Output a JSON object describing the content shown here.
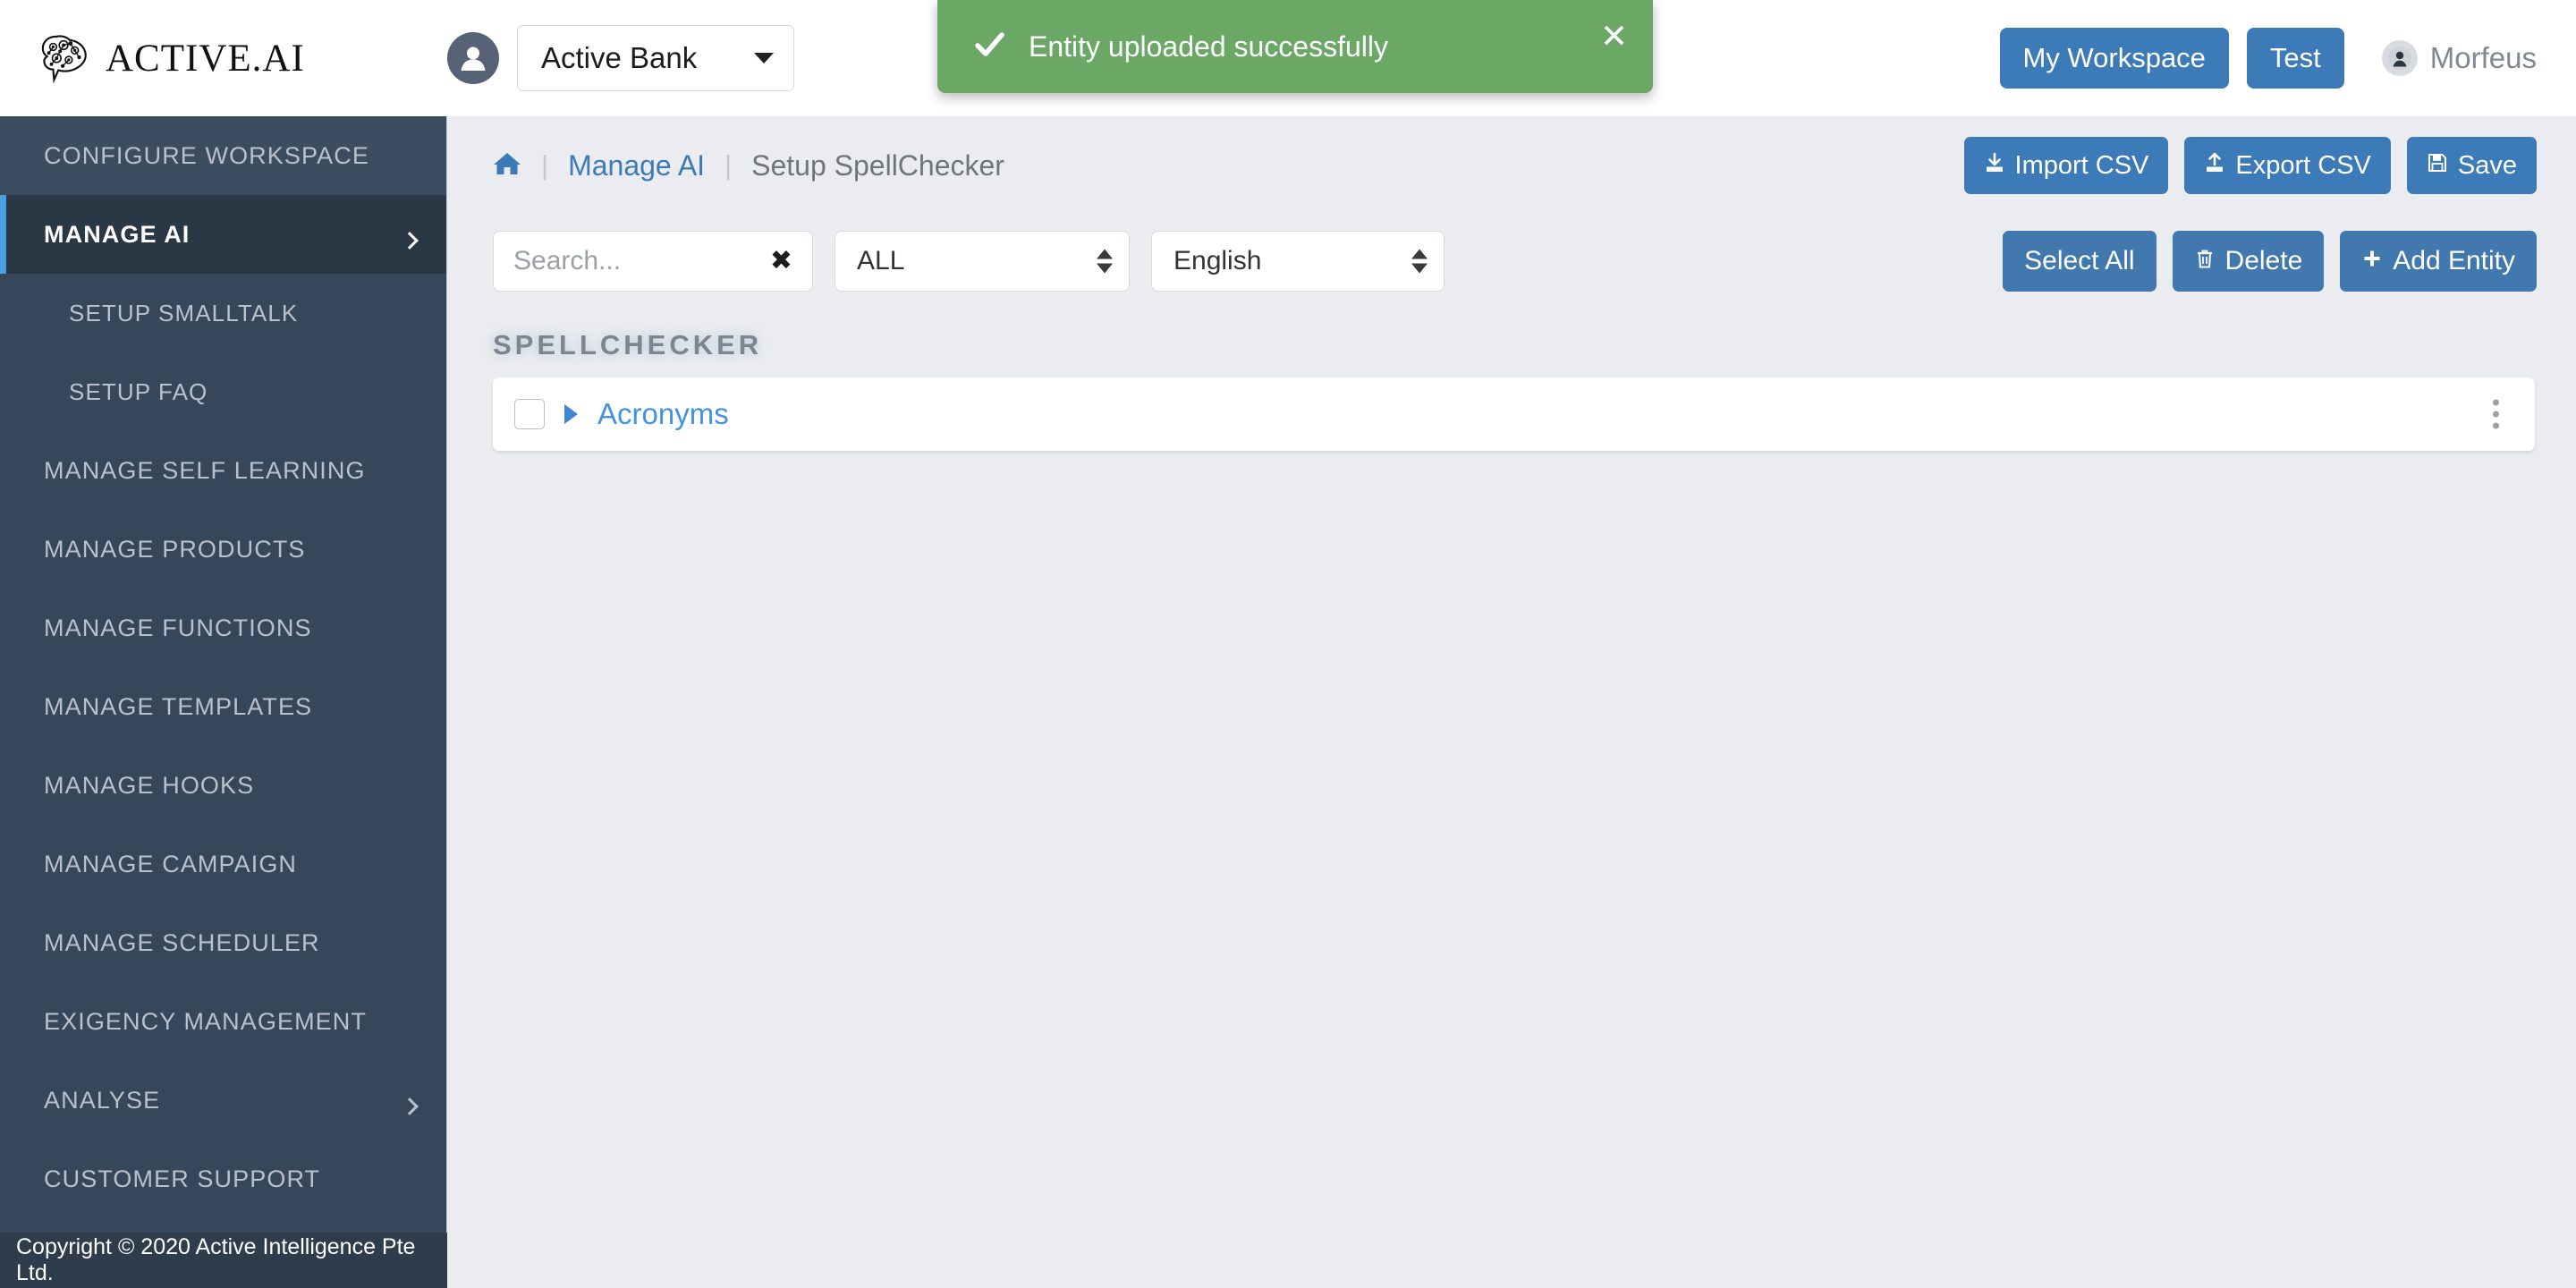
{
  "brand": {
    "name": "ACTIVE.AI",
    "logo_icon": "brain-icon"
  },
  "header": {
    "org_avatar_icon": "user-avatar-icon",
    "org_name": "Active Bank",
    "org_caret_icon": "caret-down-icon",
    "workspace_button": "My Workspace",
    "test_button": "Test",
    "user_name": "Morfeus",
    "user_avatar_icon": "user-circle-icon",
    "accent_blue": "#3d7ab8"
  },
  "toast": {
    "message": "Entity uploaded successfully",
    "check_icon": "check-icon",
    "close_icon": "close-icon",
    "close_label": "✕",
    "background": "#6ba866"
  },
  "sidebar": {
    "items": [
      {
        "label": "CONFIGURE WORKSPACE",
        "style": "head",
        "chevron": false
      },
      {
        "label": "MANAGE AI",
        "style": "active",
        "chevron": true
      },
      {
        "label": "SETUP SMALLTALK",
        "style": "sub",
        "chevron": false
      },
      {
        "label": "SETUP FAQ",
        "style": "sub",
        "chevron": false
      },
      {
        "label": "MANAGE SELF LEARNING",
        "style": "",
        "chevron": false
      },
      {
        "label": "MANAGE PRODUCTS",
        "style": "",
        "chevron": false
      },
      {
        "label": "MANAGE FUNCTIONS",
        "style": "",
        "chevron": false
      },
      {
        "label": "MANAGE TEMPLATES",
        "style": "",
        "chevron": false
      },
      {
        "label": "MANAGE HOOKS",
        "style": "",
        "chevron": false
      },
      {
        "label": "MANAGE CAMPAIGN",
        "style": "",
        "chevron": false
      },
      {
        "label": "MANAGE SCHEDULER",
        "style": "",
        "chevron": false
      },
      {
        "label": "EXIGENCY MANAGEMENT",
        "style": "",
        "chevron": false
      },
      {
        "label": "ANALYSE",
        "style": "",
        "chevron": true
      },
      {
        "label": "CUSTOMER SUPPORT",
        "style": "",
        "chevron": false
      }
    ],
    "footer": "Copyright © 2020 Active Intelligence Pte Ltd.",
    "active_accent": "#4a9fe0",
    "background": "#37475a"
  },
  "breadcrumb": {
    "home_icon": "home-icon",
    "separator": "|",
    "link": "Manage AI",
    "current": "Setup SpellChecker"
  },
  "page_actions": {
    "import_csv": "Import CSV",
    "import_icon": "download-icon",
    "export_csv": "Export CSV",
    "export_icon": "upload-icon",
    "save": "Save",
    "save_icon": "floppy-disk-icon"
  },
  "filters": {
    "search_value": "",
    "search_placeholder": "Search...",
    "search_clear_icon": "clear-icon",
    "search_clear_label": "✖",
    "type_selected": "ALL",
    "language_selected": "English",
    "spinner_icon": "updown-spinner-icon"
  },
  "list_actions": {
    "select_all": "Select All",
    "delete": "Delete",
    "delete_icon": "trash-icon",
    "add_entity": "Add Entity",
    "add_icon": "plus-icon"
  },
  "content": {
    "section_title": "SPELLCHECKER",
    "rows": [
      {
        "label": "Acronyms",
        "checked": false,
        "expanded": false,
        "caret_icon": "caret-right-icon",
        "menu_icon": "kebab-menu-icon"
      }
    ]
  }
}
